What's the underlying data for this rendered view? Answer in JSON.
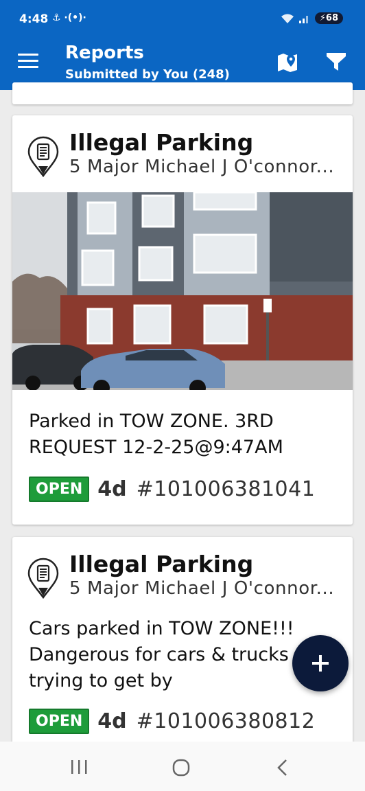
{
  "status_bar": {
    "time": "4:48",
    "left_icons": "⚓ ·(•)·",
    "battery": "68"
  },
  "app_bar": {
    "title": "Reports",
    "subtitle": "Submitted by You (248)",
    "menu_icon": "hamburger-icon",
    "map_icon": "map-pin-icon",
    "filter_icon": "filter-icon"
  },
  "reports": [
    {
      "title": "Illegal Parking",
      "address": "5 Major Michael J O'connor...",
      "description": "Parked in TOW ZONE. 3RD REQUEST 12-2-25@9:47AM",
      "status": "OPEN",
      "age": "4d",
      "ticket": "#101006381041",
      "status_color": "#1e9c3a"
    },
    {
      "title": "Illegal Parking",
      "address": "5 Major Michael J O'connor...",
      "description": "Cars parked in TOW ZONE!!! Dangerous for cars & trucks trying to get by",
      "status": "OPEN",
      "age": "4d",
      "ticket": "#101006380812",
      "status_color": "#1e9c3a"
    }
  ],
  "fab": {
    "icon": "plus-icon"
  },
  "nav_bar": {
    "recents_icon": "recents-icon",
    "home_icon": "home-icon",
    "back_icon": "back-icon"
  },
  "colors": {
    "primary": "#0b66c3",
    "fab": "#0c1a3a",
    "open_badge": "#1e9c3a"
  }
}
